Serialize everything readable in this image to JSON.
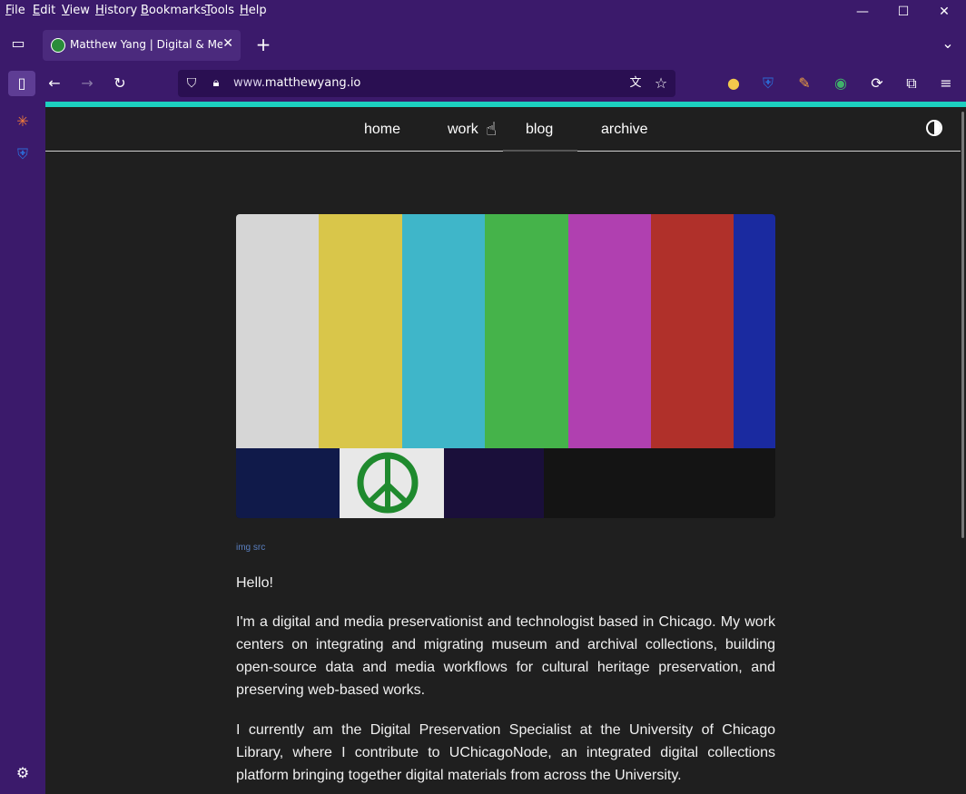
{
  "menubar": {
    "items": [
      {
        "label": "File",
        "key": "F",
        "rest": "ile"
      },
      {
        "label": "Edit",
        "key": "E",
        "rest": "dit"
      },
      {
        "label": "View",
        "key": "V",
        "rest": "iew"
      },
      {
        "label": "History",
        "key": "H",
        "rest": "istory"
      },
      {
        "label": "Bookmarks",
        "key": "B",
        "rest": "ookmarks"
      },
      {
        "label": "Tools",
        "key": "T",
        "rest": "ools"
      },
      {
        "label": "Help",
        "key": "H",
        "rest": "elp"
      }
    ]
  },
  "tab": {
    "title": "Matthew Yang | Digital & Media Preservation",
    "close": "✕",
    "new_tab": "+"
  },
  "urlbar": {
    "domain_prefix": "www.",
    "domain": "matthewyang.io"
  },
  "site_nav": {
    "links": [
      "home",
      "work",
      "blog",
      "archive"
    ]
  },
  "colors": {
    "accent": "#1ccfc0",
    "chrome": "#3b1a6b",
    "page_bg": "#1f1f1f",
    "link": "#5a7fc0"
  },
  "hero": {
    "caption": "img src"
  },
  "content": {
    "greeting": "Hello!",
    "para1": "I'm a digital and media preservationist and technologist based in Chicago. My work centers on integrating and migrating museum and archival collections, building open-source data and media workflows for cultural heritage preservation, and preserving web-based works.",
    "para2": "I currently am the Digital Preservation Specialist at the University of Chicago Library, where I contribute to UChicagoNode, an integrated digital collections platform bringing together digital materials from across the University."
  }
}
